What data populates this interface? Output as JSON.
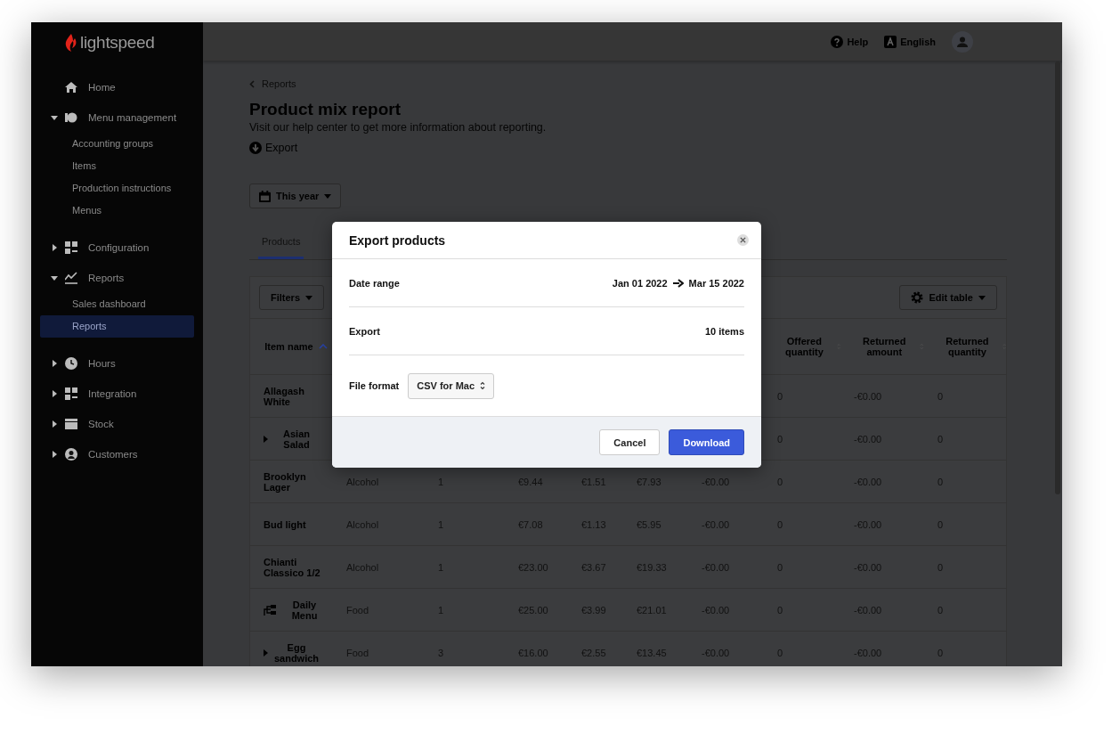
{
  "brand": "lightspeed",
  "sidebar": {
    "items": [
      {
        "label": "Home"
      },
      {
        "label": "Menu management",
        "expanded": true,
        "children": [
          {
            "label": "Accounting groups",
            "selected": false
          },
          {
            "label": "Items",
            "selected": false
          },
          {
            "label": "Production instructions",
            "selected": false
          },
          {
            "label": "Menus",
            "selected": false
          }
        ]
      },
      {
        "label": "Configuration",
        "expanded": false
      },
      {
        "label": "Reports",
        "expanded": true,
        "children": [
          {
            "label": "Sales dashboard",
            "selected": false
          },
          {
            "label": "Reports",
            "selected": true
          }
        ]
      },
      {
        "label": "Hours",
        "expanded": false
      },
      {
        "label": "Integration",
        "expanded": false
      },
      {
        "label": "Stock",
        "expanded": false
      },
      {
        "label": "Customers",
        "expanded": false
      }
    ]
  },
  "topbar": {
    "help": "Help",
    "language": "English"
  },
  "breadcrumb": "Reports",
  "title": "Product mix report",
  "subtitle": "Visit our help center to get more information about reporting.",
  "export_link": "Export",
  "period": "This year",
  "tabs": [
    {
      "label": "Products",
      "selected": true
    }
  ],
  "toolbar": {
    "filters": "Filters",
    "edit_table": "Edit table"
  },
  "table": {
    "columns": [
      {
        "label": "Item name",
        "sorted": true
      },
      {},
      {},
      {},
      {},
      {},
      {},
      {
        "label": "Offered quantity",
        "sorted": false
      },
      {
        "label": "Returned amount",
        "sorted": false
      },
      {
        "label": "Returned quantity",
        "sorted": false
      }
    ],
    "rows": [
      {
        "kind": "plain",
        "cells": [
          "Allagash White",
          "",
          "",
          "",
          "",
          "",
          "",
          "0",
          "-€0.00",
          "0"
        ]
      },
      {
        "kind": "expandable",
        "cells": [
          "Asian Salad",
          "",
          "",
          "",
          "",
          "",
          "",
          "0",
          "-€0.00",
          "0"
        ]
      },
      {
        "kind": "plain",
        "cells": [
          "Brooklyn Lager",
          "Alcohol",
          "1",
          "€9.44",
          "€1.51",
          "€7.93",
          "-€0.00",
          "0",
          "-€0.00",
          "0"
        ]
      },
      {
        "kind": "plain",
        "cells": [
          "Bud light",
          "Alcohol",
          "1",
          "€7.08",
          "€1.13",
          "€5.95",
          "-€0.00",
          "0",
          "-€0.00",
          "0"
        ]
      },
      {
        "kind": "plain",
        "cells": [
          "Chianti Classico 1/2",
          "Alcohol",
          "1",
          "€23.00",
          "€3.67",
          "€19.33",
          "-€0.00",
          "0",
          "-€0.00",
          "0"
        ]
      },
      {
        "kind": "combo",
        "cells": [
          "Daily Menu",
          "Food",
          "1",
          "€25.00",
          "€3.99",
          "€21.01",
          "-€0.00",
          "0",
          "-€0.00",
          "0"
        ]
      },
      {
        "kind": "expandable",
        "cells": [
          "Egg sandwich",
          "Food",
          "3",
          "€16.00",
          "€2.55",
          "€13.45",
          "-€0.00",
          "0",
          "-€0.00",
          "0"
        ]
      }
    ]
  },
  "dialog": {
    "title": "Export products",
    "date_range": {
      "label": "Date range",
      "from": "Jan 01 2022",
      "to": "Mar 15 2022"
    },
    "export": {
      "label": "Export",
      "value": "10 items"
    },
    "file_format": {
      "label": "File format",
      "value": "CSV for Mac"
    },
    "buttons": {
      "cancel": "Cancel",
      "download": "Download"
    }
  }
}
